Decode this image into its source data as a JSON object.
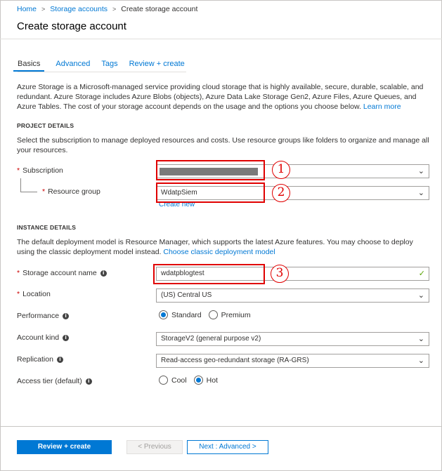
{
  "breadcrumb": {
    "home": "Home",
    "storage_accounts": "Storage accounts",
    "current": "Create storage account",
    "separator": ">"
  },
  "page_title": "Create storage account",
  "tabs": [
    {
      "label": "Basics"
    },
    {
      "label": "Advanced"
    },
    {
      "label": "Tags"
    },
    {
      "label": "Review + create"
    }
  ],
  "intro": {
    "text": "Azure Storage is a Microsoft-managed service providing cloud storage that is highly available, secure, durable, scalable, and redundant. Azure Storage includes Azure Blobs (objects), Azure Data Lake Storage Gen2, Azure Files, Azure Queues, and Azure Tables. The cost of your storage account depends on the usage and the options you choose below.",
    "link": "Learn more"
  },
  "project_details": {
    "title": "PROJECT DETAILS",
    "description": "Select the subscription to manage deployed resources and costs. Use resource groups like folders to organize and manage all your resources.",
    "subscription_label": "Subscription",
    "resource_group_label": "Resource group",
    "resource_group_value": "WdatpSiem",
    "create_new": "Create new"
  },
  "instance_details": {
    "title": "INSTANCE DETAILS",
    "description": "The default deployment model is Resource Manager, which supports the latest Azure features. You may choose to deploy using the classic deployment model instead.",
    "link": "Choose classic deployment model",
    "storage_name_label": "Storage account name",
    "storage_name_value": "wdatpblogtest",
    "location_label": "Location",
    "location_value": "(US) Central US",
    "performance_label": "Performance",
    "performance_options": [
      "Standard",
      "Premium"
    ],
    "performance_selected": "Standard",
    "account_kind_label": "Account kind",
    "account_kind_value": "StorageV2 (general purpose v2)",
    "replication_label": "Replication",
    "replication_value": "Read-access geo-redundant storage (RA-GRS)",
    "access_tier_label": "Access tier (default)",
    "access_tier_options": [
      "Cool",
      "Hot"
    ],
    "access_tier_selected": "Hot"
  },
  "annotations": [
    "1",
    "2",
    "3"
  ],
  "footer": {
    "review_create": "Review + create",
    "previous": "< Previous",
    "next": "Next : Advanced >"
  },
  "icons": {
    "chevron": "chevron-down-icon",
    "check": "checkmark-icon",
    "info": "info-icon"
  },
  "colors": {
    "accent": "#0078d4",
    "highlight": "#e00000",
    "required": "#cc0000",
    "valid": "#57a300"
  }
}
